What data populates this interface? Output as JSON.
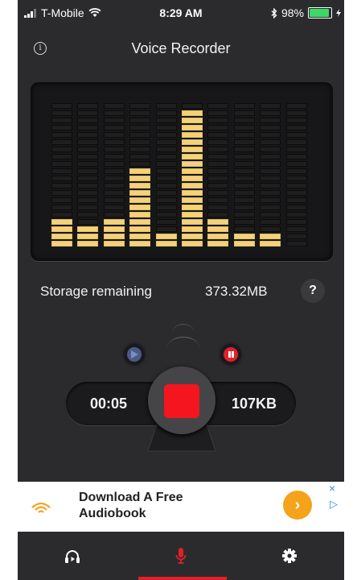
{
  "status_bar": {
    "carrier": "T-Mobile",
    "time": "8:29 AM",
    "battery_percent": "98%"
  },
  "nav": {
    "title": "Voice Recorder",
    "info_label": "i"
  },
  "equalizer": {
    "columns": 10,
    "segments_per_column": 20,
    "levels": [
      4,
      3,
      4,
      11,
      2,
      19,
      4,
      2,
      2,
      0
    ],
    "active_color": "#f3d27e"
  },
  "storage": {
    "label": "Storage remaining",
    "value": "373.32MB",
    "help_label": "?"
  },
  "recorder": {
    "elapsed": "00:05",
    "file_size": "107KB",
    "record_color": "#f4151e"
  },
  "ad": {
    "line1": "Download A Free",
    "line2": "Audiobook",
    "cta": "›",
    "close": "×",
    "adchoices": "▷"
  },
  "tabs": [
    {
      "name": "listen",
      "icon": "headphones-play-icon",
      "active": false
    },
    {
      "name": "record",
      "icon": "microphone-icon",
      "active": true
    },
    {
      "name": "settings",
      "icon": "gear-icon",
      "active": false
    }
  ]
}
